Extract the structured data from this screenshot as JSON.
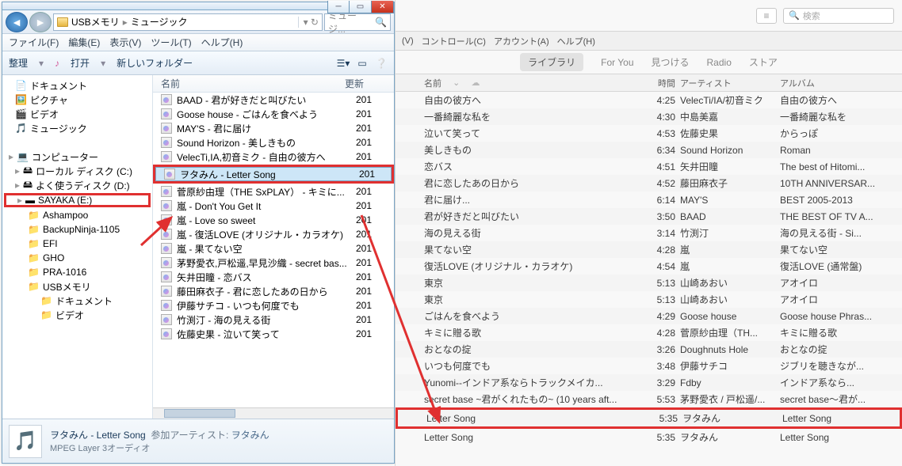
{
  "explorer": {
    "breadcrumb": {
      "segments": [
        "USBメモリ",
        "ミュージック"
      ]
    },
    "search_placeholder": "ミュージ...",
    "menu": [
      "ファイル(F)",
      "編集(E)",
      "表示(V)",
      "ツール(T)",
      "ヘルプ(H)"
    ],
    "toolbar": {
      "organize": "整理",
      "open": "打开",
      "new_folder": "新しいフォルダー"
    },
    "tree": [
      {
        "label": "ドキュメント",
        "icon": "doc",
        "indent": 1
      },
      {
        "label": "ピクチャ",
        "icon": "pic",
        "indent": 1
      },
      {
        "label": "ビデオ",
        "icon": "vid",
        "indent": 1
      },
      {
        "label": "ミュージック",
        "icon": "music",
        "indent": 1
      },
      {
        "label": "",
        "icon": "",
        "indent": 0
      },
      {
        "label": "コンピューター",
        "icon": "computer",
        "indent": 0
      },
      {
        "label": "ローカル ディスク (C:)",
        "icon": "hdd",
        "indent": 1
      },
      {
        "label": "よく使うディスク (D:)",
        "icon": "hdd",
        "indent": 1
      },
      {
        "label": "SAYAKA (E:)",
        "icon": "usb",
        "indent": 1,
        "highlight": true
      },
      {
        "label": "Ashampoo",
        "icon": "folder",
        "indent": 2
      },
      {
        "label": "BackupNinja-1105",
        "icon": "folder",
        "indent": 2
      },
      {
        "label": "EFI",
        "icon": "folder",
        "indent": 2
      },
      {
        "label": "GHO",
        "icon": "folder",
        "indent": 2
      },
      {
        "label": "PRA-1016",
        "icon": "folder",
        "indent": 2
      },
      {
        "label": "USBメモリ",
        "icon": "folder",
        "indent": 2
      },
      {
        "label": "ドキュメント",
        "icon": "folder",
        "indent": 3
      },
      {
        "label": "ビデオ",
        "icon": "folder",
        "indent": 3
      }
    ],
    "file_header": {
      "name": "名前",
      "date": "更新"
    },
    "files": [
      {
        "name": "BAAD - 君が好きだと叫びたい",
        "date": "201"
      },
      {
        "name": "Goose house - ごはんを食べよう",
        "date": "201"
      },
      {
        "name": "MAY'S - 君に届け",
        "date": "201"
      },
      {
        "name": "Sound Horizon - 美しきもの",
        "date": "201"
      },
      {
        "name": "VelecTi,IA,初音ミク - 自由の彼方へ",
        "date": "201"
      },
      {
        "name": "ヲタみん - Letter Song",
        "date": "201",
        "selected": true,
        "highlight": true
      },
      {
        "name": "菅原紗由理（THE SxPLAY） - キミに...",
        "date": "201"
      },
      {
        "name": "嵐 - Don't You Get It",
        "date": "201"
      },
      {
        "name": "嵐 - Love so sweet",
        "date": "201"
      },
      {
        "name": "嵐 - 復活LOVE (オリジナル・カラオケ)",
        "date": "201"
      },
      {
        "name": "嵐 - 果てない空",
        "date": "201"
      },
      {
        "name": "茅野愛衣,戸松遥,早見沙織 - secret bas...",
        "date": "201"
      },
      {
        "name": "矢井田瞳 - 恋バス",
        "date": "201"
      },
      {
        "name": "藤田麻衣子 - 君に恋したあの日から",
        "date": "201"
      },
      {
        "name": "伊藤サチコ - いつも何度でも",
        "date": "201"
      },
      {
        "name": "竹渕汀 - 海の見える街",
        "date": "201"
      },
      {
        "name": "佐藤史果 - 泣いて笑って",
        "date": "201"
      }
    ],
    "details": {
      "title": "ヲタみん - Letter Song",
      "artist_label": "参加アーティスト:",
      "artist": "ヲタみん",
      "subtitle": "MPEG Layer 3オーディオ"
    }
  },
  "itunes": {
    "search_placeholder": "検索",
    "menu": [
      "(V)",
      "コントロール(C)",
      "アカウント(A)",
      "ヘルプ(H)"
    ],
    "tabs": [
      "ライブラリ",
      "For You",
      "見つける",
      "Radio",
      "ストア"
    ],
    "columns": {
      "name": "名前",
      "time": "時間",
      "artist": "アーティスト",
      "album": "アルバム"
    },
    "songs": [
      {
        "name": "自由の彼方へ",
        "time": "4:25",
        "artist": "VelecTi/IA/初音ミク",
        "album": "自由の彼方へ"
      },
      {
        "name": "一番綺麗な私を",
        "time": "4:30",
        "artist": "中島美嘉",
        "album": "一番綺麗な私を"
      },
      {
        "name": "泣いて笑って",
        "time": "4:53",
        "artist": "佐藤史果",
        "album": "からっぽ"
      },
      {
        "name": "美しきもの",
        "time": "6:34",
        "artist": "Sound Horizon",
        "album": "Roman"
      },
      {
        "name": "恋バス",
        "time": "4:51",
        "artist": "矢井田瞳",
        "album": "The best of Hitomi..."
      },
      {
        "name": "君に恋したあの日から",
        "time": "4:52",
        "artist": "藤田麻衣子",
        "album": "10TH ANNIVERSAR..."
      },
      {
        "name": "君に届け...",
        "time": "6:14",
        "artist": "MAY'S",
        "album": "BEST 2005-2013"
      },
      {
        "name": "君が好きだと叫びたい",
        "time": "3:50",
        "artist": "BAAD",
        "album": "THE BEST OF TV A..."
      },
      {
        "name": "海の見える街",
        "time": "3:14",
        "artist": "竹渕汀",
        "album": "海の見える街 - Si..."
      },
      {
        "name": "果てない空",
        "time": "4:28",
        "artist": "嵐",
        "album": "果てない空"
      },
      {
        "name": "復活LOVE (オリジナル・カラオケ)",
        "time": "4:54",
        "artist": "嵐",
        "album": "復活LOVE (通常盤)"
      },
      {
        "name": "東京",
        "time": "5:13",
        "artist": "山崎あおい",
        "album": "アオイロ"
      },
      {
        "name": "東京",
        "time": "5:13",
        "artist": "山崎あおい",
        "album": "アオイロ"
      },
      {
        "name": "ごはんを食べよう",
        "time": "4:29",
        "artist": "Goose house",
        "album": "Goose house Phras..."
      },
      {
        "name": "キミに贈る歌",
        "time": "4:28",
        "artist": "菅原紗由理（TH...",
        "album": "キミに贈る歌"
      },
      {
        "name": "おとなの掟",
        "time": "3:26",
        "artist": "Doughnuts Hole",
        "album": "おとなの掟"
      },
      {
        "name": "いつも何度でも",
        "time": "3:48",
        "artist": "伊藤サチコ",
        "album": "ジブリを聴きなが..."
      },
      {
        "name": "Yunomi--インドア系ならトラックメイカ...",
        "time": "3:29",
        "artist": "Fdby",
        "album": "インドア系なら..."
      },
      {
        "name": "secret base ~君がくれたもの~ (10 years aft...",
        "time": "5:53",
        "artist": "茅野愛衣 / 戸松遥/...",
        "album": "secret base～君が..."
      },
      {
        "name": "Letter Song",
        "time": "5:35",
        "artist": "ヲタみん",
        "album": "Letter Song",
        "highlight": true
      },
      {
        "name": "Letter Song",
        "time": "5:35",
        "artist": "ヲタみん",
        "album": "Letter Song"
      }
    ]
  }
}
